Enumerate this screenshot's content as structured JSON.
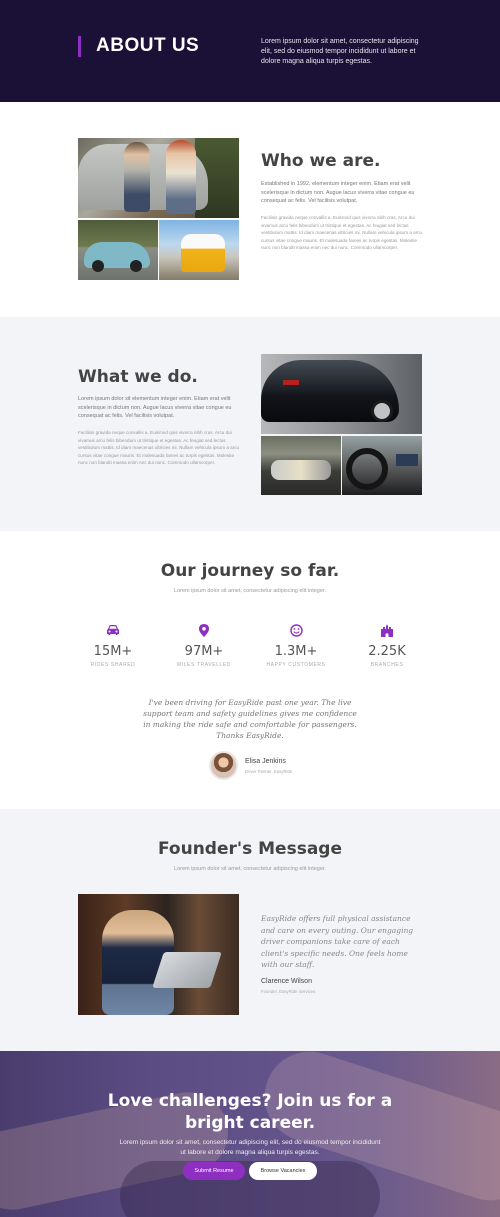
{
  "hero": {
    "title": "ABOUT US",
    "text": "Lorem ipsum dolor sit amet, consectetur adipiscing elit, sed do eiusmod tempor incididunt ut labore et dolore magna aliqua turpis egestas."
  },
  "who": {
    "title": "Who we are.",
    "lead": "Established in 1992, elementum integer enim. Etiam erat velit scelerisque in dictum non. Augue lacus viverra vitae congue eu consequat ac felis. Vel facilisis volutpat.",
    "body": "Facilisis gravida neque convallis a. Euismod quis viverra nibh cras. Arcu dui vivamus arcu felis bibendum ut tristique et egestas. Ac feugiat sed lectus vestibulum mattis. Id diam maecenas ultricies mi. Nullam vehicula ipsum a arcu cursus vitae congue mauris. Et malesuada fames ac turpis egestas. Molestie nunc non blandit massa enim nec dui nunc. Commodo ullamcorper."
  },
  "what": {
    "title": "What we do.",
    "lead": "Lorem ipsum dolor sit elementum integer enim. Etiam erat velit scelerisque in dictum non. Augue lacus viverra vitae congue eu consequat ac felis. Vel facilisis volutpat.",
    "body": "Facilisis gravida neque convallis a. Euismod quis viverra nibh cras. Arcu dui vivamus arcu felis bibendum ut tristique et egestas. Ac feugiat sed lectus vestibulum mattis. Id diam maecenas ultricies mi. Nullam vehicula ipsum a arcu cursus vitae congue mauris. Et malesuada fames ac turpis egestas. Molestie nunc non blandit massa enim nec dui nunc. Commodo ullamcorper."
  },
  "journey": {
    "title": "Our journey so far.",
    "subtitle": "Lorem ipsum dolor sit amet, consectetur adipiscing elit integer.",
    "stats": [
      {
        "icon": "car-icon",
        "value": "15M+",
        "label": "RIDES SHARED"
      },
      {
        "icon": "map-pin-icon",
        "value": "97M+",
        "label": "MILES TRAVELLED"
      },
      {
        "icon": "smile-icon",
        "value": "1.3M+",
        "label": "HAPPY CUSTOMERS"
      },
      {
        "icon": "branch-icon",
        "value": "2.25K",
        "label": "BRANCHES"
      }
    ],
    "testimonial": {
      "quote": "I've been driving for EasyRide past one year. The live support team and safety guidelines gives me confidence in making the ride safe and comfortable for passengers. Thanks EasyRide.",
      "name": "Elisa Jenkins",
      "role": "Driver Partner, EasyRide"
    }
  },
  "founder": {
    "title": "Founder's Message",
    "subtitle": "Lorem ipsum dolor sit amet, consectetur adipiscing elit integer.",
    "quote": "EasyRide offers full physical assistance and care on every outing. Our engaging driver companions take care of each client's specific needs. One feels home with our staff.",
    "name": "Clarence Wilson",
    "role": "Founder, EasyRide Services"
  },
  "cta": {
    "title": "Love challenges? Join us for a bright career.",
    "text": "Lorem ipsum dolor sit amet, consectetur adipiscing elit, sed do eiusmod tempor incididunt ut labore et dolore magna aliqua turpis egestas.",
    "primary_button": "Submit Resume",
    "secondary_button": "Browse Vacancies"
  },
  "colors": {
    "hero_bg": "#1b1035",
    "accent": "#8e2fc1",
    "section_gray": "#f3f4f7"
  }
}
